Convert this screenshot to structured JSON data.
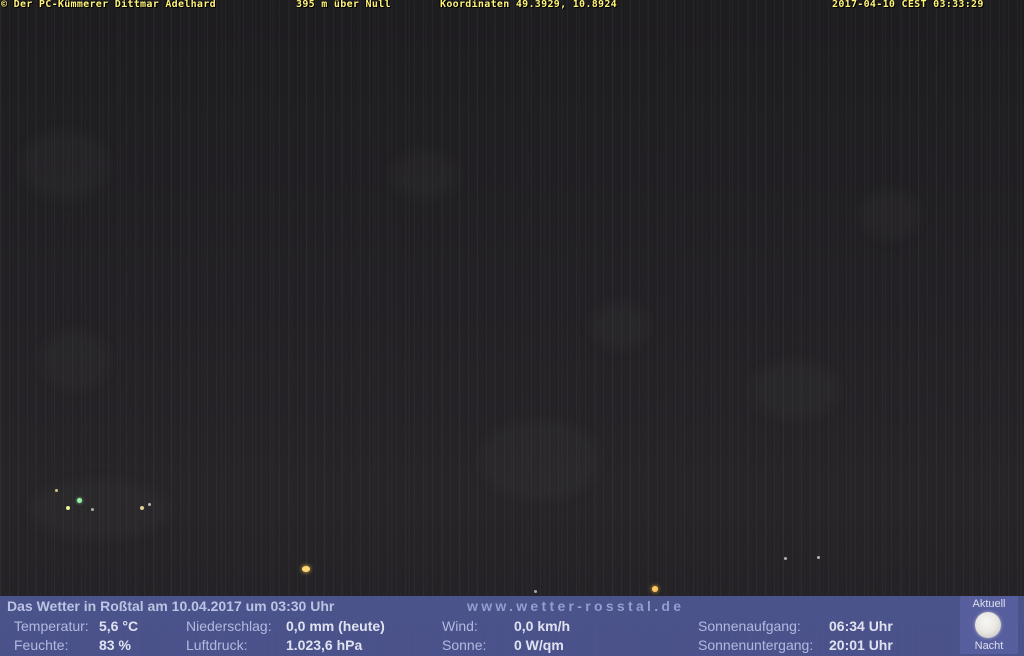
{
  "overlay": {
    "copyright": "© Der PC-Kümmerer Dittmar Adelhard",
    "altitude": "395 m über Null",
    "coordinates": "Koordinaten 49.3929, 10.8924",
    "timestamp": "2017-04-10 CEST 03:33:29"
  },
  "weather": {
    "title": "Das Wetter in Roßtal am 10.04.2017 um 03:30 Uhr",
    "website": "www.wetter-rosstal.de",
    "temperature_label": "Temperatur:",
    "temperature_value": "5,6 °C",
    "humidity_label": "Feuchte:",
    "humidity_value": "83 %",
    "precipitation_label": "Niederschlag:",
    "precipitation_value": "0,0 mm (heute)",
    "pressure_label": "Luftdruck:",
    "pressure_value": "1.023,6 hPa",
    "wind_label": "Wind:",
    "wind_value": "0,0 km/h",
    "sun_label": "Sonne:",
    "sun_value": "0 W/qm",
    "sunrise_label": "Sonnenaufgang:",
    "sunrise_value": "06:34 Uhr",
    "sunset_label": "Sonnenuntergang:",
    "sunset_value": "20:01 Uhr",
    "moon_top_label": "Aktuell",
    "moon_bottom_label": "Nacht"
  },
  "colors": {
    "overlay_text": "#fff37a",
    "panel_background": "#4d5590",
    "panel_label": "#b8c0e6",
    "panel_value": "#e8ebf8"
  }
}
